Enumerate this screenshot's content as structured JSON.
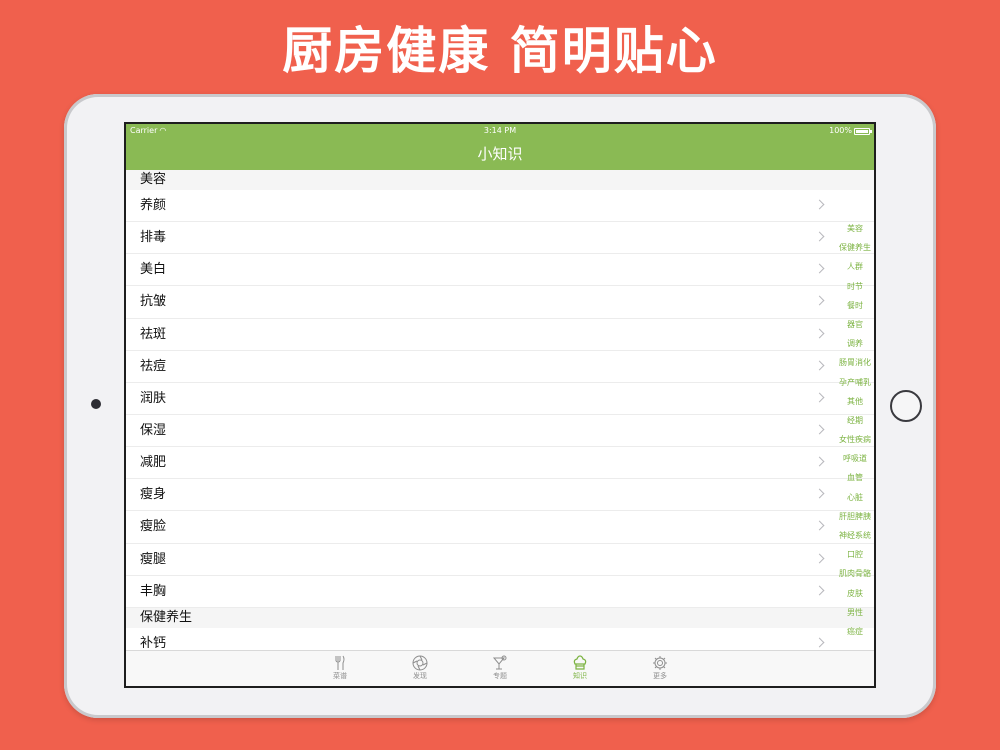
{
  "headline": "厨房健康 简明贴心",
  "status_bar": {
    "carrier": "Carrier",
    "time": "3:14 PM",
    "battery": "100%"
  },
  "nav": {
    "title": "小知识"
  },
  "sections": [
    {
      "header": "美容",
      "rows": [
        "养颜",
        "排毒",
        "美白",
        "抗皱",
        "祛斑",
        "祛痘",
        "润肤",
        "保湿",
        "减肥",
        "瘦身",
        "瘦脸",
        "瘦腿",
        "丰胸"
      ]
    },
    {
      "header": "保健养生",
      "rows": [
        "补钙"
      ]
    }
  ],
  "index": [
    "美容",
    "保健养生",
    "人群",
    "时节",
    "餐时",
    "器官",
    "调养",
    "肠胃消化",
    "孕产哺乳",
    "其他",
    "经期",
    "女性疾病",
    "呼吸道",
    "血管",
    "心脏",
    "肝胆脾胰",
    "神经系统",
    "口腔",
    "肌肉骨骼",
    "皮肤",
    "男性",
    "癌症"
  ],
  "tabs": [
    {
      "label": "菜谱",
      "icon": "fork-knife-icon",
      "active": false
    },
    {
      "label": "发现",
      "icon": "aperture-icon",
      "active": false
    },
    {
      "label": "专题",
      "icon": "cocktail-icon",
      "active": false
    },
    {
      "label": "知识",
      "icon": "chef-hat-icon",
      "active": true
    },
    {
      "label": "更多",
      "icon": "gear-icon",
      "active": false
    }
  ],
  "colors": {
    "background": "#f0604d",
    "accent": "#8aba54",
    "index_text": "#7cb342"
  }
}
